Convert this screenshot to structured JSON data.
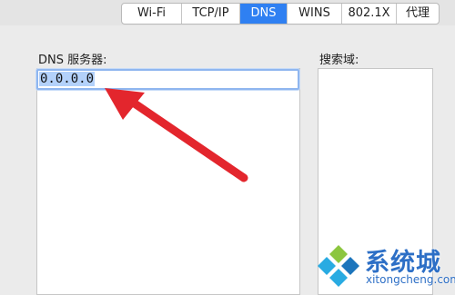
{
  "tabs": [
    {
      "label": "Wi-Fi",
      "active": false
    },
    {
      "label": "TCP/IP",
      "active": false
    },
    {
      "label": "DNS",
      "active": true
    },
    {
      "label": "WINS",
      "active": false
    },
    {
      "label": "802.1X",
      "active": false
    },
    {
      "label": "代理",
      "active": false
    }
  ],
  "dns_servers": {
    "label": "DNS 服务器:",
    "entries": [
      "0.0.0.0"
    ]
  },
  "search_domains": {
    "label": "搜索域:"
  },
  "watermark": {
    "title": "系统城",
    "domain": "xitongcheng.com"
  },
  "colors": {
    "tab_active": "#2f80f2",
    "selection": "#b3d1fa",
    "arrow": "#e3262d",
    "watermark": "#2d6fc6"
  }
}
